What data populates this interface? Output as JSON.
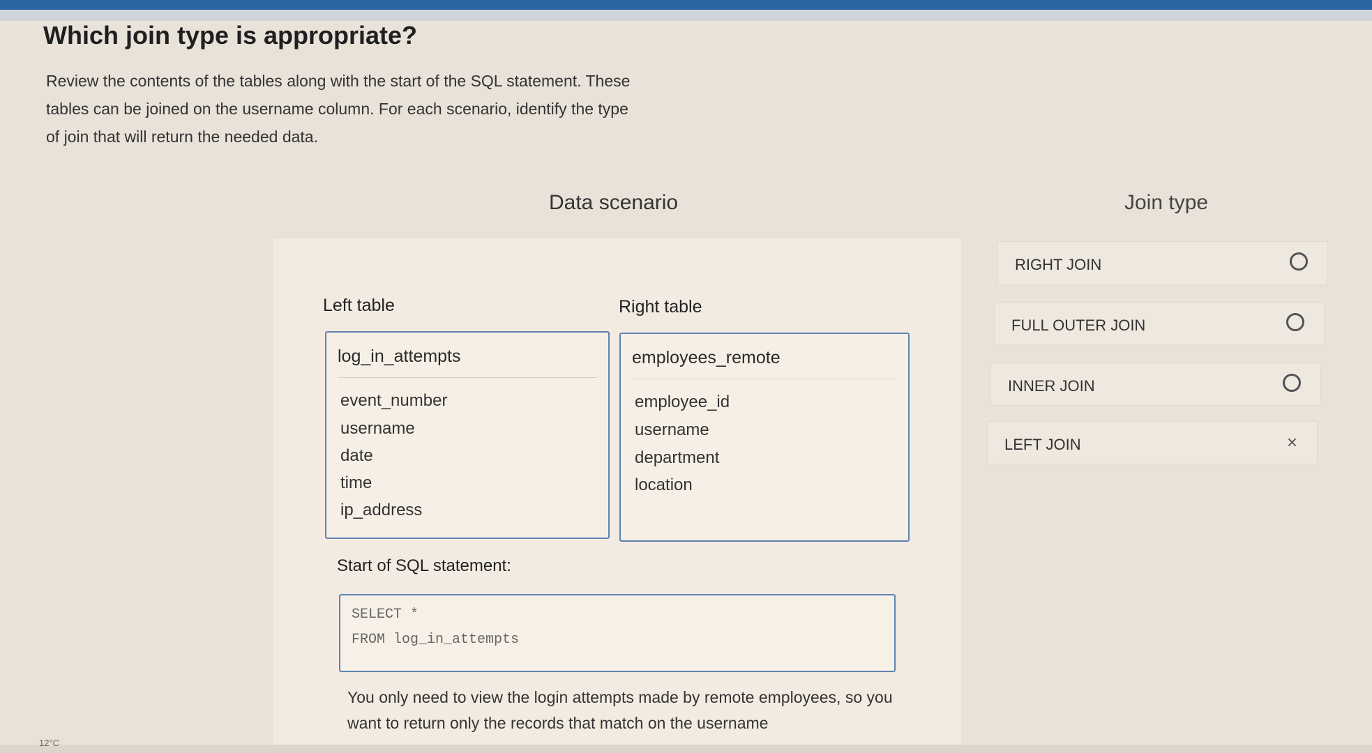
{
  "question": {
    "title": "Which join type is appropriate?",
    "intro": "Review the contents of the tables along with the start of the SQL statement. These tables can be joined on the username column. For each scenario, identify the type of join that will return the needed data."
  },
  "columns": {
    "data_scenario": "Data scenario",
    "join_type": "Join type"
  },
  "left_table": {
    "label": "Left table",
    "name": "log_in_attempts",
    "fields": [
      "event_number",
      "username",
      "date",
      "time",
      "ip_address"
    ]
  },
  "right_table": {
    "label": "Right table",
    "name": "employees_remote",
    "fields": [
      "employee_id",
      "username",
      "department",
      "location"
    ]
  },
  "sql": {
    "label": "Start of SQL statement:",
    "lines": [
      "SELECT *",
      "FROM log_in_attempts"
    ]
  },
  "scenario": {
    "text": "You only need to view the login attempts made by remote employees, so you want to return only the records that match on the username"
  },
  "join_options": [
    {
      "label": "RIGHT JOIN",
      "state": "unselected"
    },
    {
      "label": "FULL OUTER JOIN",
      "state": "unselected"
    },
    {
      "label": "INNER JOIN",
      "state": "unselected"
    },
    {
      "label": "LEFT JOIN",
      "state": "incorrect"
    }
  ],
  "taskbar": {
    "temperature": "12°C"
  },
  "colors": {
    "accent_border": "#5f83b0",
    "top_bar": "#2d64a3"
  }
}
